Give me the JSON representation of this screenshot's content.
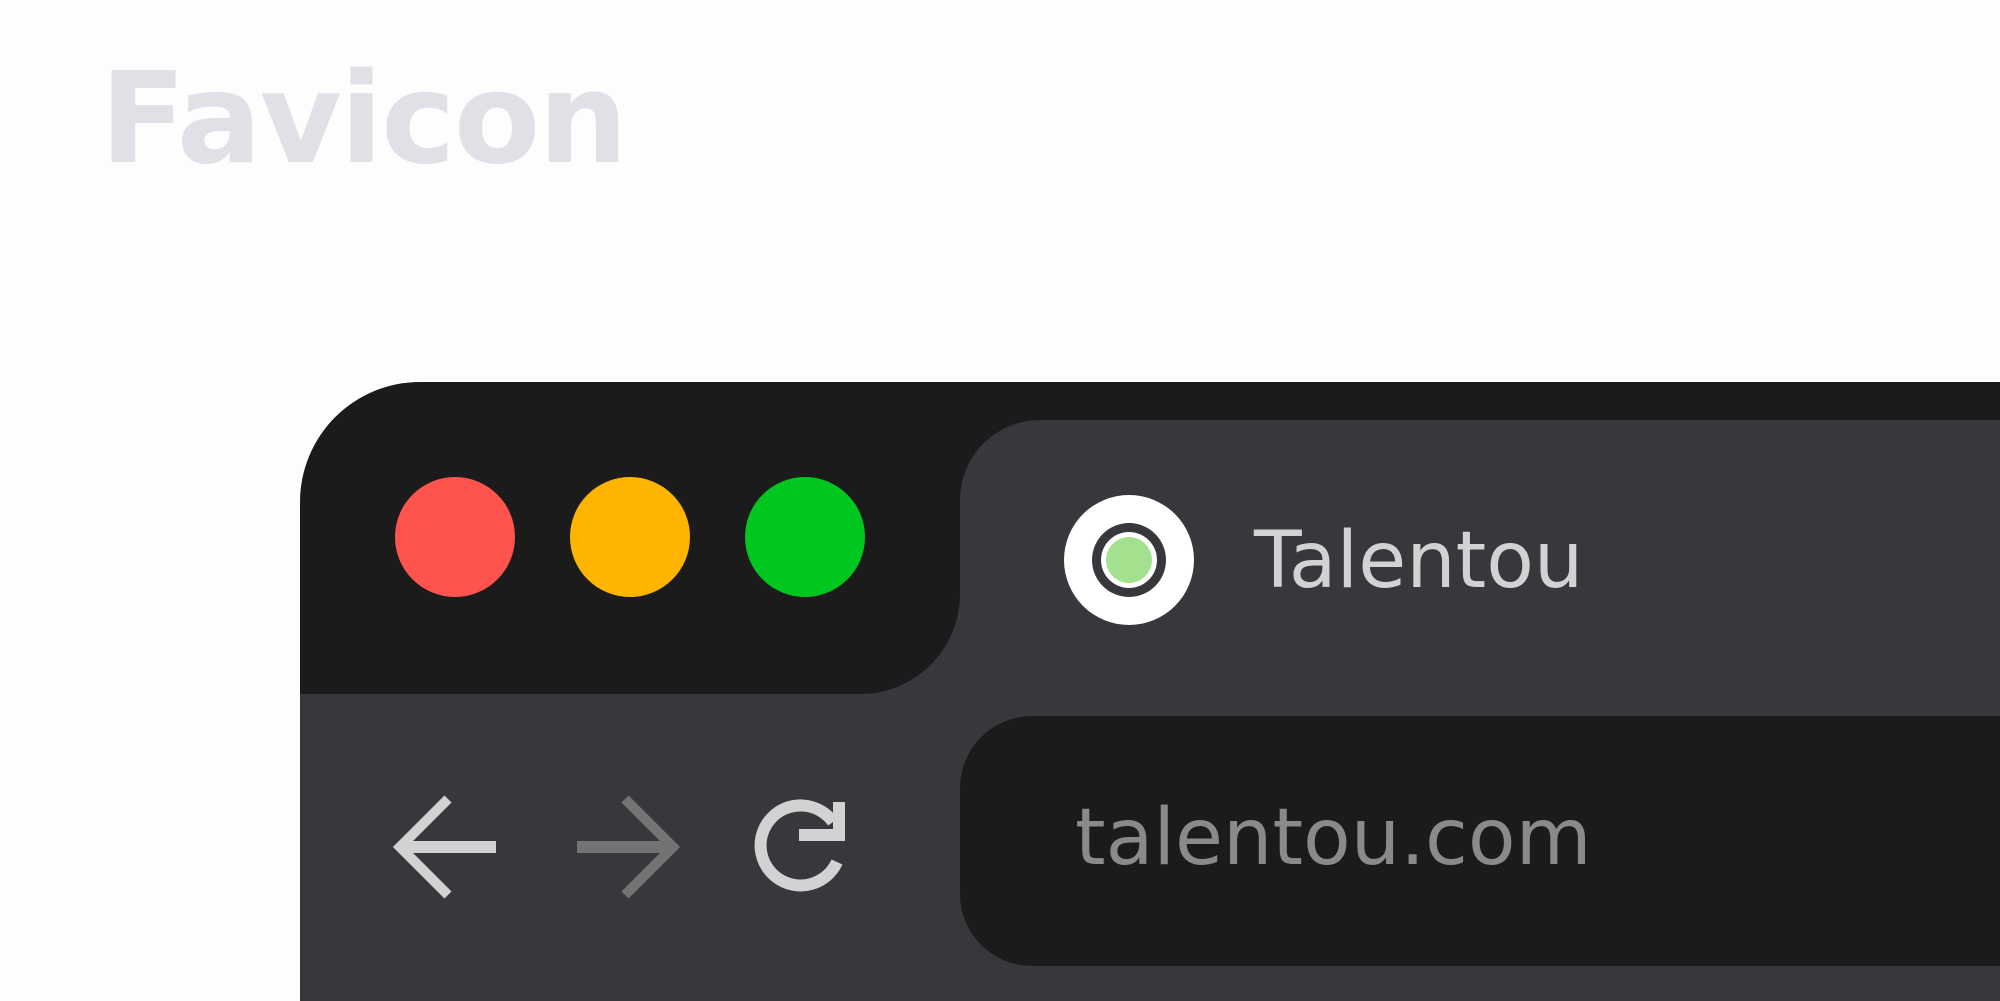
{
  "heading": "Favicon",
  "window": {
    "traffic_lights": {
      "close_color": "#ff544d",
      "minimize_color": "#ffb400",
      "zoom_color": "#00c620"
    },
    "tab": {
      "title": "Talentou",
      "favicon": "target-dot-icon",
      "favicon_accent": "#a3e18f"
    },
    "nav": {
      "back_icon": "arrow-left-icon",
      "forward_icon": "arrow-right-icon",
      "reload_icon": "reload-icon",
      "forward_enabled": false
    },
    "address_bar": {
      "url": "talentou.com"
    }
  }
}
